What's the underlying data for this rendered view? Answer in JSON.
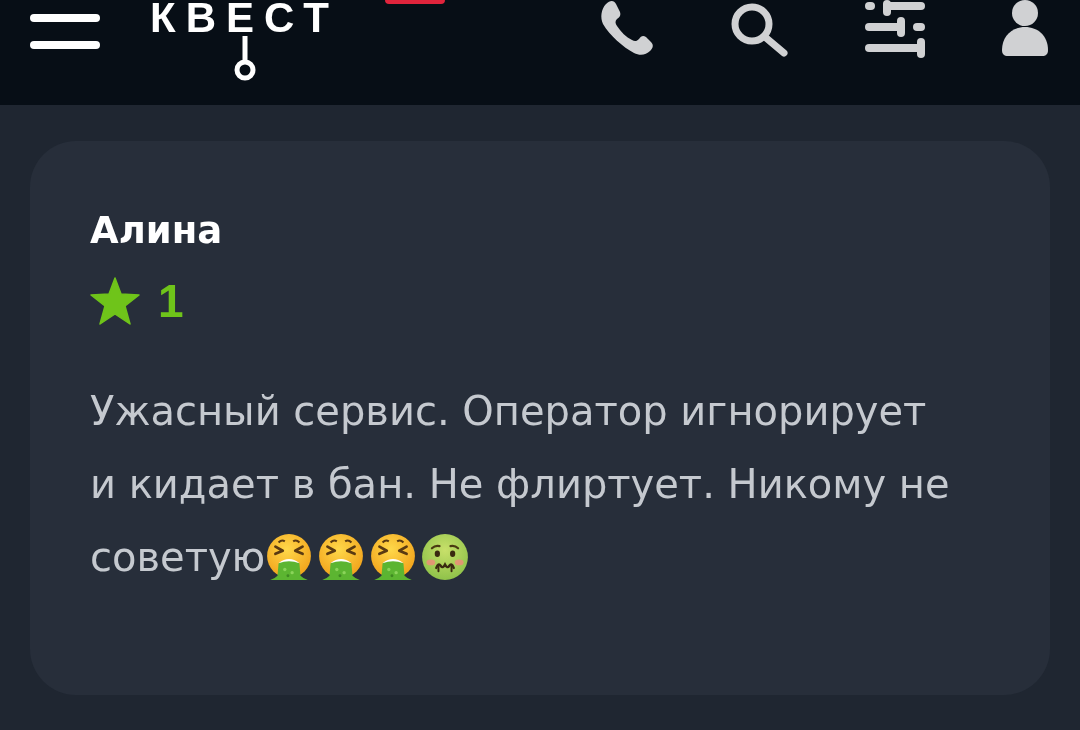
{
  "header": {
    "logo": "КВЕСТ"
  },
  "review": {
    "author": "Алина",
    "rating": "1",
    "text": "Ужасный сервис. Оператор игнорирует и кидает в бан. Не флиртует. Никому не советую",
    "emoji": [
      {
        "kind": "vomiting"
      },
      {
        "kind": "vomiting"
      },
      {
        "kind": "vomiting"
      },
      {
        "kind": "nauseated"
      }
    ]
  }
}
